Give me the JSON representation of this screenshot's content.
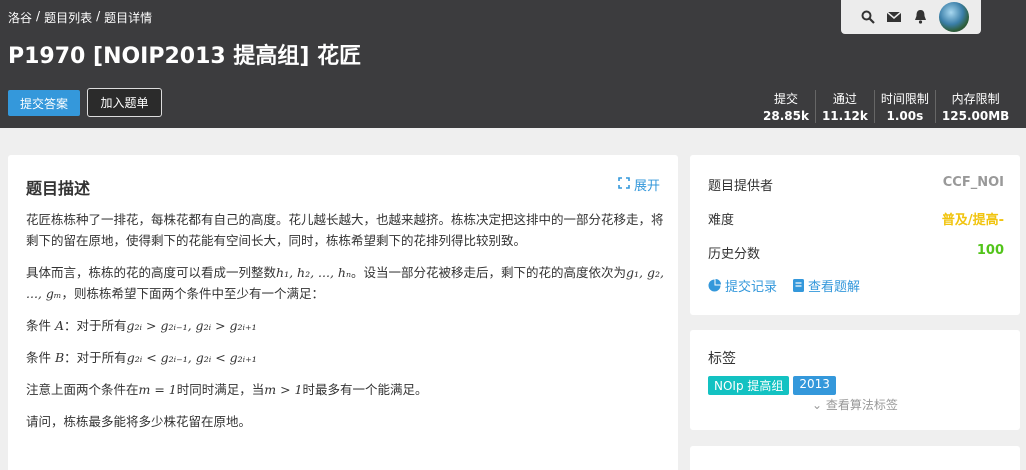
{
  "breadcrumb": [
    "洛谷",
    "/",
    "题目列表",
    "/",
    "题目详情"
  ],
  "title": "P1970 [NOIP2013 提高组] 花匠",
  "buttons": {
    "submit": "提交答案",
    "add_to_list": "加入题单"
  },
  "stats": [
    {
      "label": "提交",
      "value": "28.85k"
    },
    {
      "label": "通过",
      "value": "11.12k"
    },
    {
      "label": "时间限制",
      "value": "1.00s"
    },
    {
      "label": "内存限制",
      "value": "125.00MB"
    }
  ],
  "user_icons": [
    "search-icon",
    "mail-icon",
    "bell-icon",
    "avatar"
  ],
  "description": {
    "heading": "题目描述",
    "expand": "展开",
    "p1": "花匠栋栋种了一排花，每株花都有自己的高度。花儿越长越大，也越来越挤。栋栋决定把这排中的一部分花移走，将剩下的留在原地，使得剩下的花能有空间长大，同时，栋栋希望剩下的花排列得比较别致。",
    "p2a": "具体而言，栋栋的花的高度可以看成一列整数",
    "p2m1": "h₁, h₂, ..., hₙ",
    "p2b": "。设当一部分花被移走后，剩下的花的高度依次为",
    "p2m2": "g₁, g₂, ..., gₘ",
    "p2c": "，则栋栋希望下面两个条件中至少有一个满足：",
    "cA_label": "条件 ",
    "cA_var": "A",
    "cA_text": "：对于所有",
    "cA_math": "g₂ᵢ > g₂ᵢ₋₁, g₂ᵢ > g₂ᵢ₊₁",
    "cB_label": "条件 ",
    "cB_var": "B",
    "cB_text": "：对于所有",
    "cB_math": "g₂ᵢ < g₂ᵢ₋₁, g₂ᵢ < g₂ᵢ₊₁",
    "p3a": "注意上面两个条件在",
    "p3m1": "m = 1",
    "p3b": "时同时满足，当",
    "p3m2": "m > 1",
    "p3c": "时最多有一个能满足。",
    "p4": "请问，栋栋最多能将多少株花留在原地。"
  },
  "side_info": {
    "provider_label": "题目提供者",
    "provider_value": "CCF_NOI",
    "difficulty_label": "难度",
    "difficulty_value": "普及/提高-",
    "score_label": "历史分数",
    "score_value": "100",
    "submit_record": "提交记录",
    "view_solution": "查看题解"
  },
  "tags_card": {
    "heading": "标签",
    "tags": [
      "NOIp 提高组",
      "2013"
    ],
    "more": "查看算法标签"
  },
  "colors": {
    "header_bg": "#3c3c3e",
    "accent": "#3498db",
    "difficulty": "#f1c40f",
    "score": "#52c41a",
    "tag_cyan": "#13c2c2"
  }
}
